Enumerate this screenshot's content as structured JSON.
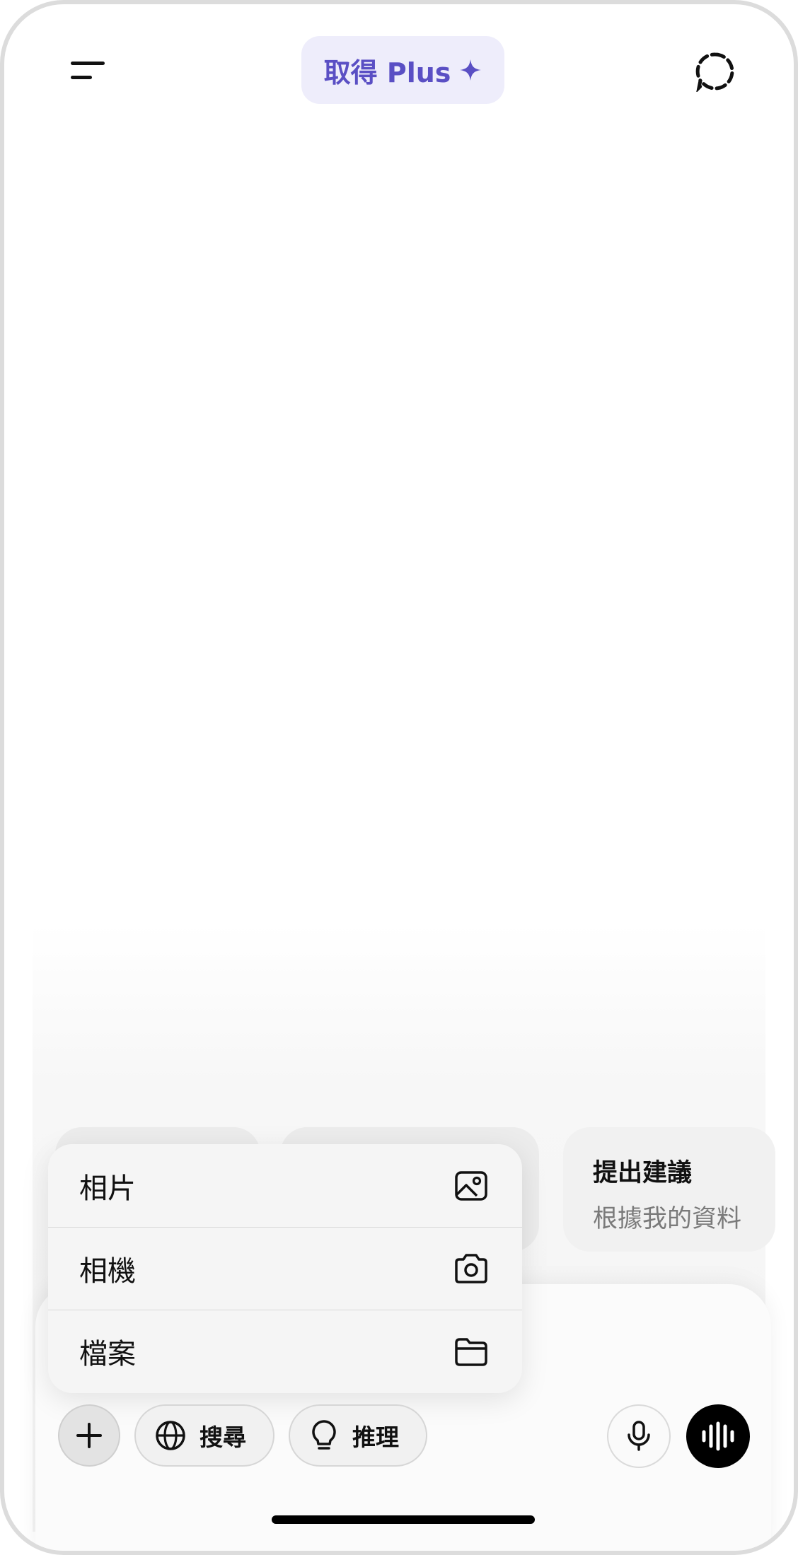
{
  "header": {
    "upgrade_label": "取得 Plus"
  },
  "suggestions": [
    {
      "title": "",
      "subtitle": ""
    },
    {
      "title": "",
      "subtitle": ""
    },
    {
      "title": "提出建議",
      "subtitle": "根據我的資料"
    }
  ],
  "attach_menu": {
    "items": [
      {
        "label": "相片",
        "icon": "photo-icon"
      },
      {
        "label": "相機",
        "icon": "camera-icon"
      },
      {
        "label": "檔案",
        "icon": "folder-icon"
      }
    ]
  },
  "toolbar": {
    "search_label": "搜尋",
    "reason_label": "推理"
  },
  "colors": {
    "accent": "#5a4fc4",
    "accent_bg": "#eeedfb"
  }
}
